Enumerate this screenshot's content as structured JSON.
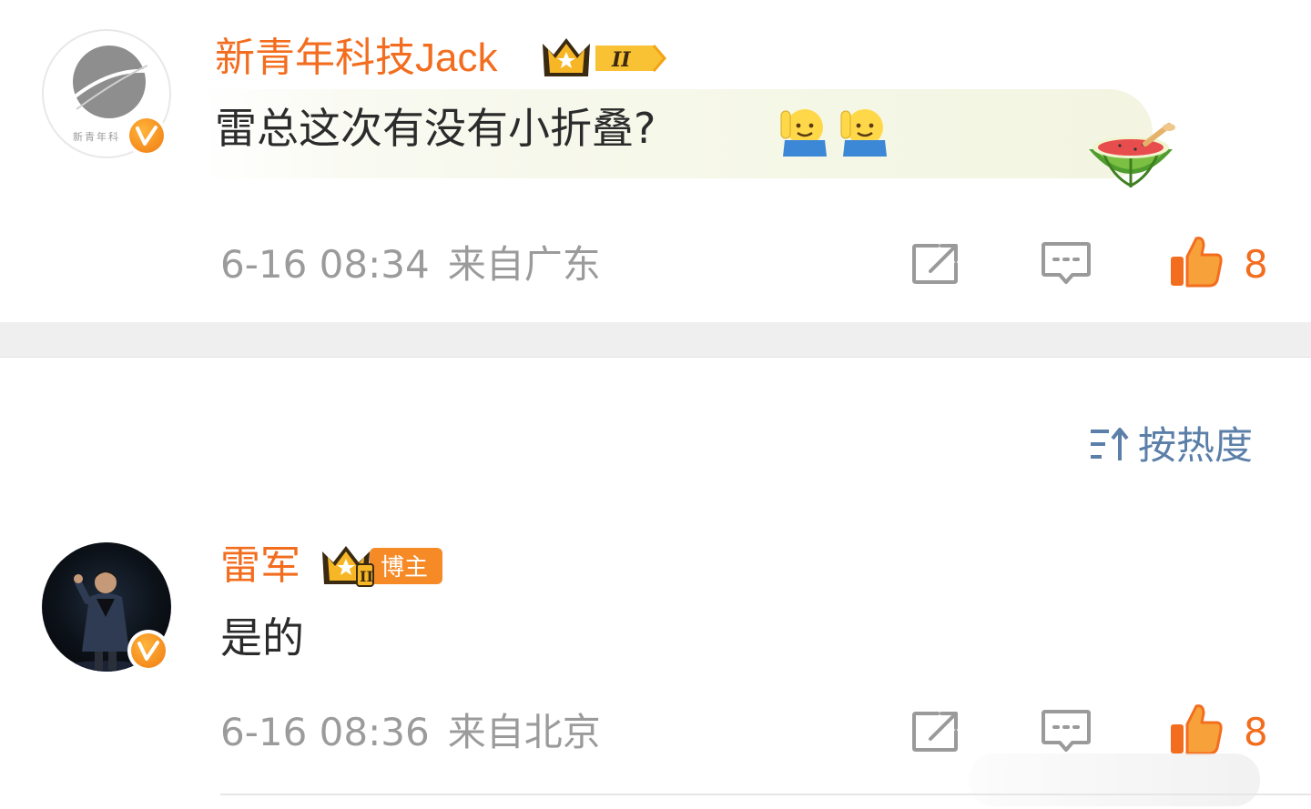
{
  "comments": [
    {
      "username": "新青年科技Jack",
      "avatar_logo_text": "新青年科",
      "level_badge": "II",
      "text": "雷总这次有没有小折叠?",
      "emojis": [
        "raising-hand-emoji",
        "raising-hand-emoji"
      ],
      "sticker": "watermelon-sticker",
      "time": "6-16 08:34",
      "location": "来自广东",
      "likes": "8"
    },
    {
      "username": "雷军",
      "level_badge": "II",
      "role_badge": "博主",
      "text": "是的",
      "time": "6-16 08:36",
      "location": "来自北京",
      "likes": "8"
    }
  ],
  "sort": {
    "label": "按热度"
  },
  "colors": {
    "username": "#f36d1f",
    "meta": "#9b9b9b",
    "sort": "#5b7fa8",
    "like": "#f36d1f"
  }
}
